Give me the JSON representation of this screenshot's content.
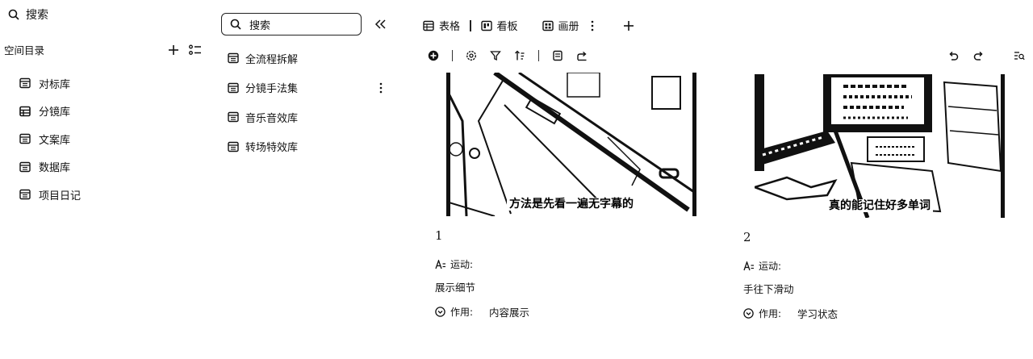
{
  "left_sidebar": {
    "search_label": "搜索",
    "section_title": "空间目录",
    "items": [
      {
        "label": "对标库",
        "icon": "table-icon"
      },
      {
        "label": "分镜库",
        "icon": "grid-table-icon"
      },
      {
        "label": "文案库",
        "icon": "table-icon"
      },
      {
        "label": "数据库",
        "icon": "table-icon"
      },
      {
        "label": "项目日记",
        "icon": "table-icon"
      }
    ]
  },
  "middle_panel": {
    "search_placeholder": "搜索",
    "items": [
      {
        "label": "全流程拆解"
      },
      {
        "label": "分镜手法集"
      },
      {
        "label": "音乐音效库"
      },
      {
        "label": "转场特效库"
      }
    ]
  },
  "view_tabs": [
    {
      "label": "表格",
      "icon": "table-icon"
    },
    {
      "label": "看板",
      "icon": "kanban-icon"
    },
    {
      "label": "画册",
      "icon": "gallery-icon"
    }
  ],
  "gallery": {
    "cards": [
      {
        "title": "1",
        "subtitle_in_image": "方法是先看一遍无字幕的",
        "field_label": "运动:",
        "field_value": "展示细节",
        "tag_label": "作用:",
        "tag_value": "内容展示"
      },
      {
        "title": "2",
        "subtitle_in_image": "真的能记住好多单词",
        "field_label": "运动:",
        "field_value": "手往下滑动",
        "tag_label": "作用:",
        "tag_value": "学习状态"
      }
    ]
  }
}
